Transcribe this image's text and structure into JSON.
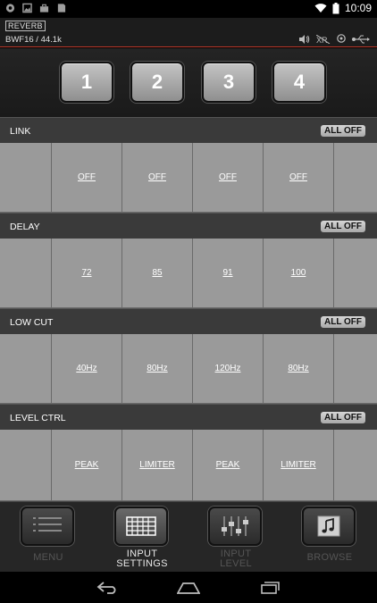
{
  "status_bar": {
    "time": "10:09",
    "left_icons": [
      "app-notification-icon",
      "image-notification-icon",
      "bag-notification-icon",
      "sd-card-icon"
    ],
    "right_icons": [
      "wifi-icon",
      "battery-icon"
    ]
  },
  "header": {
    "mode_badge": "REVERB",
    "format": "BWF16 / 44.1k",
    "icons": [
      "speaker-icon",
      "xlr-icon",
      "location-icon",
      "usb-icon"
    ],
    "accent_color": "#c0392b"
  },
  "channels": [
    "1",
    "2",
    "3",
    "4"
  ],
  "sections": [
    {
      "title": "LINK",
      "all_off_label": "ALL OFF",
      "values": [
        "OFF",
        "OFF",
        "OFF",
        "OFF"
      ]
    },
    {
      "title": "DELAY",
      "all_off_label": "ALL OFF",
      "values": [
        "72",
        "85",
        "91",
        "100"
      ]
    },
    {
      "title": "LOW CUT",
      "all_off_label": "ALL OFF",
      "values": [
        "40Hz",
        "80Hz",
        "120Hz",
        "80Hz"
      ]
    },
    {
      "title": "LEVEL CTRL",
      "all_off_label": "ALL OFF",
      "values": [
        "PEAK",
        "LIMITER",
        "PEAK",
        "LIMITER"
      ]
    }
  ],
  "bottom_nav": {
    "items": [
      {
        "label": "MENU",
        "icon": "list-icon",
        "active": false
      },
      {
        "label_line1": "INPUT",
        "label_line2": "SETTINGS",
        "icon": "grid-icon",
        "active": true
      },
      {
        "label_line1": "INPUT",
        "label_line2": "LEVEL",
        "icon": "faders-icon",
        "active": false
      },
      {
        "label": "BROWSE",
        "icon": "music-note-icon",
        "active": false
      }
    ]
  },
  "android_nav": [
    "back-icon",
    "home-icon",
    "recents-icon"
  ]
}
